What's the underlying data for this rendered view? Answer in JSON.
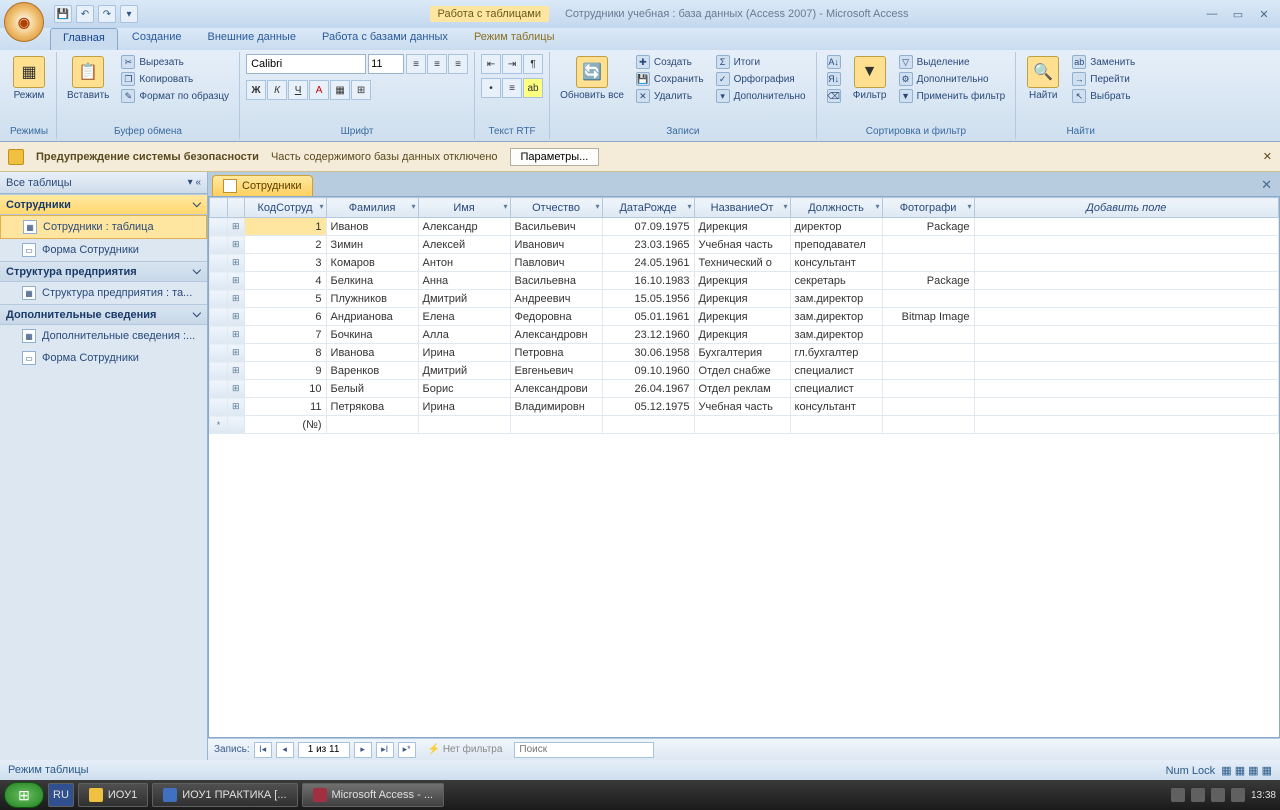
{
  "title": {
    "tools_context": "Работа с таблицами",
    "document": "Сотрудники учебная : база данных (Access 2007) - Microsoft Access"
  },
  "tabs": {
    "t1": "Главная",
    "t2": "Создание",
    "t3": "Внешние данные",
    "t4": "Работа с базами данных",
    "t5": "Режим таблицы"
  },
  "ribbon": {
    "view": {
      "label": "Режим",
      "group": "Режимы"
    },
    "paste": {
      "label": "Вставить",
      "cut": "Вырезать",
      "copy": "Копировать",
      "fmt": "Формат по образцу",
      "group": "Буфер обмена"
    },
    "font": {
      "name": "Calibri",
      "size": "11",
      "group": "Шрифт"
    },
    "rtf": {
      "group": "Текст RTF"
    },
    "refresh": {
      "label": "Обновить все",
      "group": "Записи",
      "new": "Создать",
      "save": "Сохранить",
      "delete": "Удалить",
      "totals": "Итоги",
      "spell": "Орфография",
      "more": "Дополнительно"
    },
    "sort": {
      "filter": "Фильтр",
      "group": "Сортировка и фильтр",
      "sel": "Выделение",
      "adv": "Дополнительно",
      "apply": "Применить фильтр"
    },
    "find": {
      "label": "Найти",
      "group": "Найти",
      "replace": "Заменить",
      "goto": "Перейти",
      "select": "Выбрать"
    }
  },
  "security": {
    "title": "Предупреждение системы безопасности",
    "msg": "Часть содержимого базы данных отключено",
    "btn": "Параметры..."
  },
  "nav": {
    "title": "Все таблицы",
    "g1": {
      "hdr": "Сотрудники",
      "i1": "Сотрудники : таблица",
      "i2": "Форма Сотрудники"
    },
    "g2": {
      "hdr": "Структура предприятия",
      "i1": "Структура предприятия : та..."
    },
    "g3": {
      "hdr": "Дополнительные сведения",
      "i1": "Дополнительные сведения :...",
      "i2": "Форма Сотрудники"
    }
  },
  "obj_tab": "Сотрудники",
  "columns": {
    "c0": "КодСотруд",
    "c1": "Фамилия",
    "c2": "Имя",
    "c3": "Отчество",
    "c4": "ДатаРожде",
    "c5": "НазваниеОт",
    "c6": "Должность",
    "c7": "Фотографи",
    "c8": "Добавить поле"
  },
  "rows": [
    {
      "id": "1",
      "f": "Иванов",
      "n": "Александр",
      "o": "Васильевич",
      "d": "07.09.1975",
      "dep": "Дирекция",
      "pos": "директор",
      "ph": "Package"
    },
    {
      "id": "2",
      "f": "Зимин",
      "n": "Алексей",
      "o": "Иванович",
      "d": "23.03.1965",
      "dep": "Учебная часть",
      "pos": "преподавател",
      "ph": ""
    },
    {
      "id": "3",
      "f": "Комаров",
      "n": "Антон",
      "o": "Павлович",
      "d": "24.05.1961",
      "dep": "Технический о",
      "pos": "консультант",
      "ph": ""
    },
    {
      "id": "4",
      "f": "Белкина",
      "n": "Анна",
      "o": "Васильевна",
      "d": "16.10.1983",
      "dep": "Дирекция",
      "pos": "секретарь",
      "ph": "Package"
    },
    {
      "id": "5",
      "f": "Плужников",
      "n": "Дмитрий",
      "o": "Андреевич",
      "d": "15.05.1956",
      "dep": "Дирекция",
      "pos": "зам.директор",
      "ph": ""
    },
    {
      "id": "6",
      "f": "Андрианова",
      "n": "Елена",
      "o": "Федоровна",
      "d": "05.01.1961",
      "dep": "Дирекция",
      "pos": "зам.директор",
      "ph": "Bitmap Image"
    },
    {
      "id": "7",
      "f": "Бочкина",
      "n": "Алла",
      "o": "Александровн",
      "d": "23.12.1960",
      "dep": "Дирекция",
      "pos": "зам.директор",
      "ph": ""
    },
    {
      "id": "8",
      "f": "Иванова",
      "n": "Ирина",
      "o": "Петровна",
      "d": "30.06.1958",
      "dep": "Бухгалтерия",
      "pos": "гл.бухгалтер",
      "ph": ""
    },
    {
      "id": "9",
      "f": "Варенков",
      "n": "Дмитрий",
      "o": "Евгеньевич",
      "d": "09.10.1960",
      "dep": "Отдел снабже",
      "pos": "специалист",
      "ph": ""
    },
    {
      "id": "10",
      "f": "Белый",
      "n": "Борис",
      "o": "Александрови",
      "d": "26.04.1967",
      "dep": "Отдел реклам",
      "pos": "специалист",
      "ph": ""
    },
    {
      "id": "11",
      "f": "Петрякова",
      "n": "Ирина",
      "o": "Владимировн",
      "d": "05.12.1975",
      "dep": "Учебная часть",
      "pos": "консультант",
      "ph": ""
    }
  ],
  "new_row": "(№)",
  "recnav": {
    "label": "Запись:",
    "pos": "1 из 11",
    "nofilter": "Нет фильтра",
    "search": "Поиск"
  },
  "status": {
    "mode": "Режим таблицы",
    "numlock": "Num Lock"
  },
  "taskbar": {
    "lang": "RU",
    "b1": "ИОУ1",
    "b2": "ИОУ1 ПРАКТИКА [...",
    "b3": "Microsoft Access - ...",
    "time": "13:38"
  }
}
